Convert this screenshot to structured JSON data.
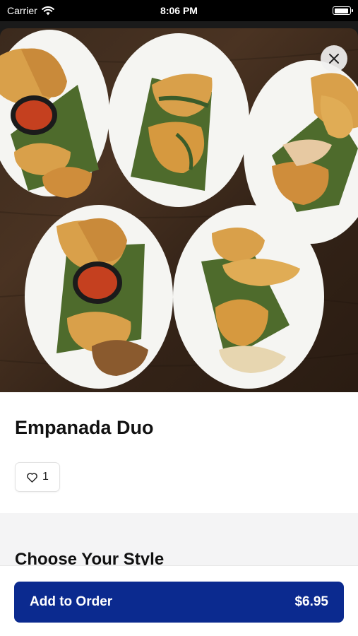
{
  "status_bar": {
    "carrier": "Carrier",
    "time": "8:06 PM",
    "battery_level": 0.95
  },
  "hero": {
    "image_subject": "empanadas on white plates with salsa and banana leaves",
    "close_icon": "close-icon"
  },
  "item": {
    "title": "Empanada Duo",
    "like_count": "1",
    "like_icon": "heart-outline-icon"
  },
  "section": {
    "title": "Choose Your Style"
  },
  "order_button": {
    "label": "Add to Order",
    "price": "$6.95"
  },
  "colors": {
    "primary": "#0b2a8f",
    "section_bg": "#f4f4f5"
  }
}
